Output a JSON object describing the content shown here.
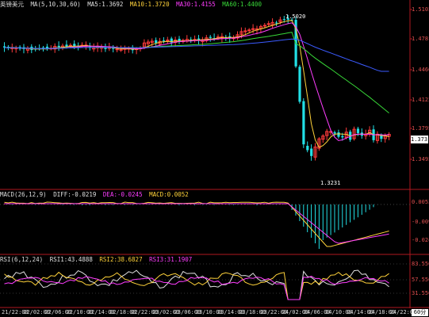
{
  "header": {
    "symbol": "英镑美元",
    "ma_label": "MA(5,10,30,60)",
    "ma5": "MA5:1.3692",
    "ma10": "MA10:1.3720",
    "ma30": "MA30:1.4155",
    "ma60": "MA60:1.4400",
    "close_label_button": "1.3731"
  },
  "price_axis": {
    "ticks": [
      "1.5103",
      "1.4781",
      "1.4460",
      "1.4123",
      "1.3795",
      "1.3493"
    ],
    "high_marker": "1.5020",
    "low_marker": "1.3231"
  },
  "macd": {
    "label": "MACD(26,12,9)",
    "diff": "DIFF:-0.0219",
    "dea": "DEA:-0.0245",
    "macd": "MACD:0.0052",
    "ticks": [
      "0.0052",
      "-0.0095",
      "-0.0243"
    ]
  },
  "rsi": {
    "label": "RSI(6,12,24)",
    "rsi1": "RSI1:43.4888",
    "rsi2": "RSI2:38.6827",
    "rsi3": "RSI3:31.1907",
    "ticks": [
      "83.550",
      "57.556",
      "31.550"
    ]
  },
  "time_axis": [
    "21/22:00",
    "22/02:00",
    "22/06:00",
    "22/10:00",
    "22/14:00",
    "22/18:00",
    "22/22:00",
    "23/02:00",
    "23/06:00",
    "23/10:00",
    "23/14:00",
    "23/18:00",
    "23/22:00",
    "24/02:00",
    "24/06:00",
    "24/10:00",
    "24/14:00",
    "24/18:00",
    "24/22:00"
  ],
  "period_button": "60分",
  "colors": {
    "up": "#ff3b3b",
    "down": "#22e0e6",
    "ma5": "#e0e0e0",
    "ma10": "#ffd23a",
    "ma30": "#ff3dff",
    "ma60": "#38d838",
    "ma_blue": "#3b5bff",
    "frame": "#b0181f"
  }
}
